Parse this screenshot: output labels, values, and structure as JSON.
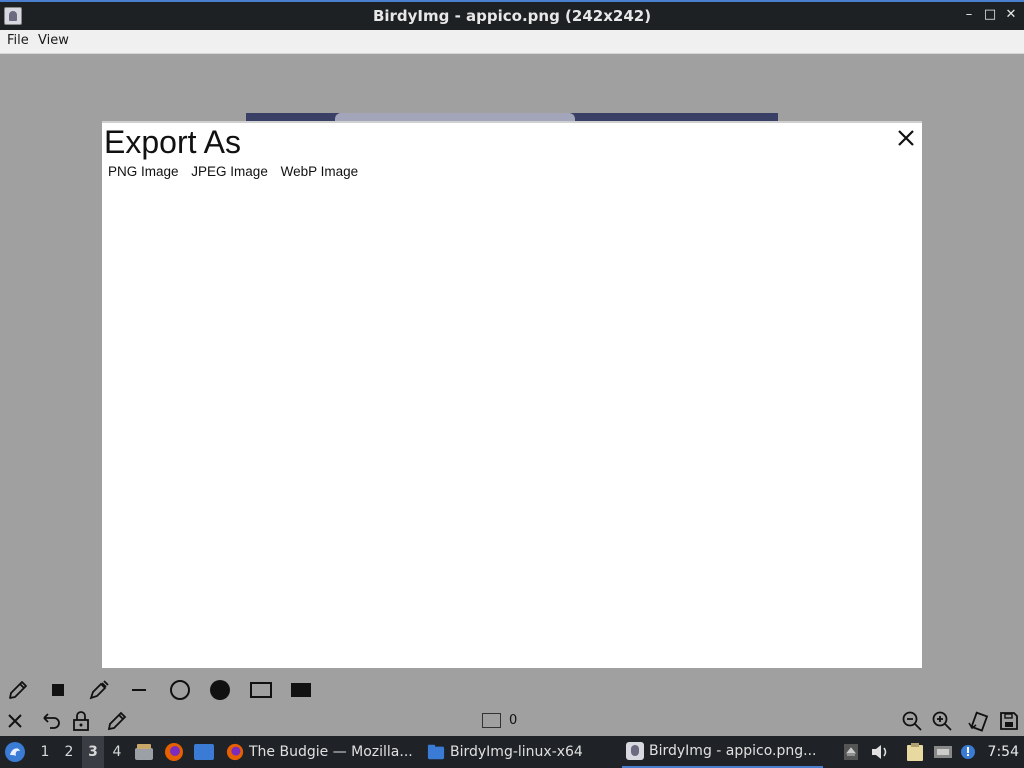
{
  "window": {
    "title": "BirdyImg - appico.png (242x242)"
  },
  "menu": [
    "File",
    "View"
  ],
  "dialog": {
    "title": "Export As",
    "formats": [
      "PNG Image",
      "JPEG Image",
      "WebP Image"
    ]
  },
  "toolbar": {
    "row1": [
      "pencil-icon",
      "small-square-icon",
      "color-picker-icon",
      "line-icon",
      "circle-outline-icon",
      "circle-filled-icon",
      "rectangle-outline-icon",
      "rectangle-filled-icon"
    ],
    "row2_left": [
      "close-icon",
      "undo-icon",
      "lock-icon",
      "edit-icon"
    ],
    "brush_size": "0",
    "row2_right": [
      "zoom-out-icon",
      "zoom-in-icon",
      "rotate-icon",
      "save-icon"
    ]
  },
  "taskbar": {
    "workspaces": [
      "1",
      "2",
      "3",
      "4"
    ],
    "active_workspace": "3",
    "tasks": [
      "The Budgie — Mozilla...",
      "BirdyImg-linux-x64",
      "BirdyImg - appico.png..."
    ],
    "clock": "7:54"
  },
  "colors": {
    "accent": "#4a7fd0",
    "panel": "#1f2226",
    "canvas": "#a0a0a0"
  }
}
